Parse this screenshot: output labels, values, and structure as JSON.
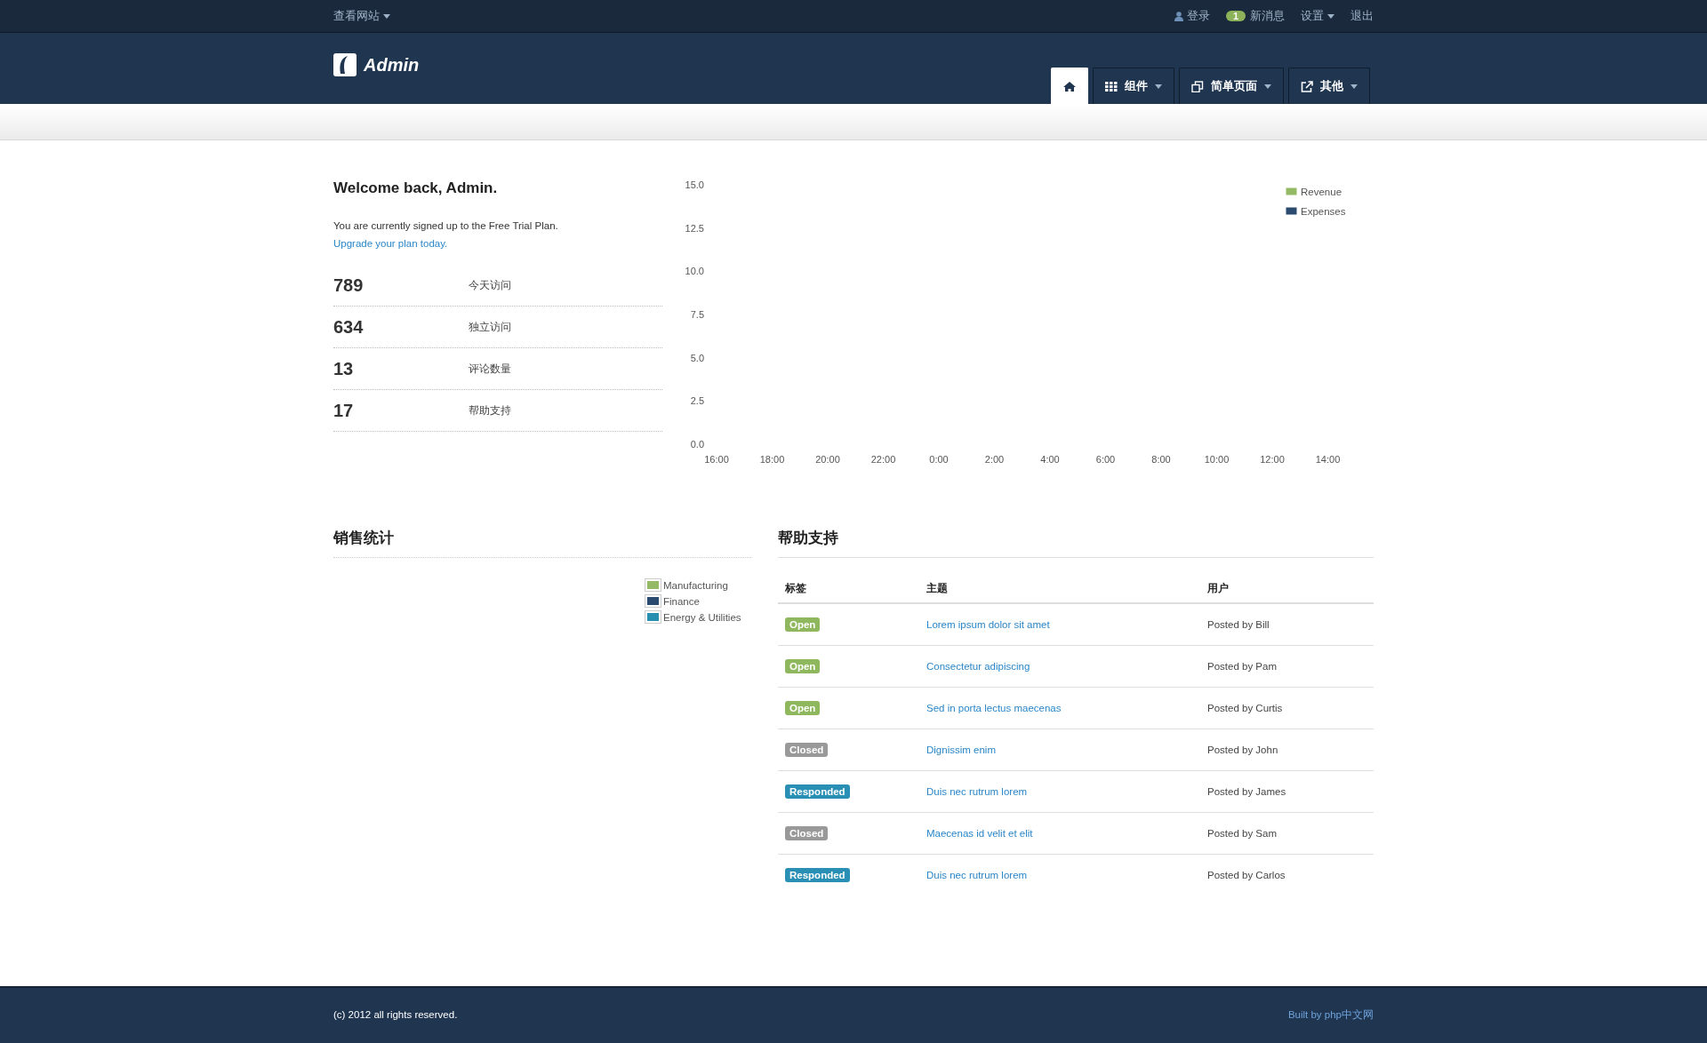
{
  "topbar": {
    "site_menu": "查看网站",
    "login": "登录",
    "message_count": "1",
    "messages": "新消息",
    "settings": "设置",
    "logout": "退出"
  },
  "header": {
    "logo": "Admin",
    "tabs": [
      {
        "kind": "home",
        "selected": true
      },
      {
        "kind": "grid",
        "label": "组件",
        "selected": false
      },
      {
        "kind": "pages",
        "label": "简单页面",
        "selected": false
      },
      {
        "kind": "external",
        "label": "其他",
        "selected": false
      }
    ]
  },
  "welcome": {
    "title": "Welcome back, Admin.",
    "text": "You are currently signed up to the Free Trial Plan.",
    "link": "Upgrade your plan today."
  },
  "stats": [
    {
      "value": "789",
      "label": "今天访问"
    },
    {
      "value": "634",
      "label": "独立访问"
    },
    {
      "value": "13",
      "label": "评论数量"
    },
    {
      "value": "17",
      "label": "帮助支持"
    }
  ],
  "traffic": {
    "chart_data": {
      "type": "line",
      "categories": [
        "16:00",
        "18:00",
        "20:00",
        "22:00",
        "0:00",
        "2:00",
        "4:00",
        "6:00",
        "8:00",
        "10:00",
        "12:00",
        "14:00"
      ],
      "ylim": [
        0,
        15
      ],
      "yticks": [
        {
          "value": 0,
          "label": "0.0"
        },
        {
          "value": 2.5,
          "label": "2.5"
        },
        {
          "value": 5,
          "label": "5.0"
        },
        {
          "value": 7.5,
          "label": "7.5"
        },
        {
          "value": 10,
          "label": "10.0"
        },
        {
          "value": 12.5,
          "label": "12.5"
        },
        {
          "value": 15,
          "label": "15.0"
        }
      ],
      "series": [
        {
          "name": "Revenue",
          "color": "#94ba65",
          "values": [
            null,
            null,
            null,
            null,
            null,
            null,
            null,
            null,
            null,
            null,
            null,
            null
          ]
        },
        {
          "name": "Expenses",
          "color": "#2b4a6f",
          "values": [
            null,
            null,
            null,
            null,
            null,
            null,
            null,
            null,
            null,
            null,
            null,
            null
          ]
        }
      ]
    }
  },
  "sales": {
    "title": "销售统计",
    "legend": [
      {
        "label": "Manufacturing",
        "color": "#94ba65"
      },
      {
        "label": "Finance",
        "color": "#2b4a6f"
      },
      {
        "label": "Energy & Utilities",
        "color": "#2790b0"
      }
    ]
  },
  "support": {
    "title": "帮助支持",
    "columns": [
      "标签",
      "主题",
      "用户"
    ],
    "rows": [
      {
        "status": "Open",
        "kind": "open",
        "subject": "Lorem ipsum dolor sit amet",
        "user": "Posted by Bill"
      },
      {
        "status": "Open",
        "kind": "open",
        "subject": "Consectetur adipiscing",
        "user": "Posted by Pam"
      },
      {
        "status": "Open",
        "kind": "open",
        "subject": "Sed in porta lectus maecenas",
        "user": "Posted by Curtis"
      },
      {
        "status": "Closed",
        "kind": "closed",
        "subject": "Dignissim enim",
        "user": "Posted by John"
      },
      {
        "status": "Responded",
        "kind": "responded",
        "subject": "Duis nec rutrum lorem",
        "user": "Posted by James"
      },
      {
        "status": "Closed",
        "kind": "closed",
        "subject": "Maecenas id velit et elit",
        "user": "Posted by Sam"
      },
      {
        "status": "Responded",
        "kind": "responded",
        "subject": "Duis nec rutrum lorem",
        "user": "Posted by Carlos"
      }
    ]
  },
  "footer": {
    "copyright": "(c) 2012 all rights reserved.",
    "credit": "Built by php中文网"
  }
}
